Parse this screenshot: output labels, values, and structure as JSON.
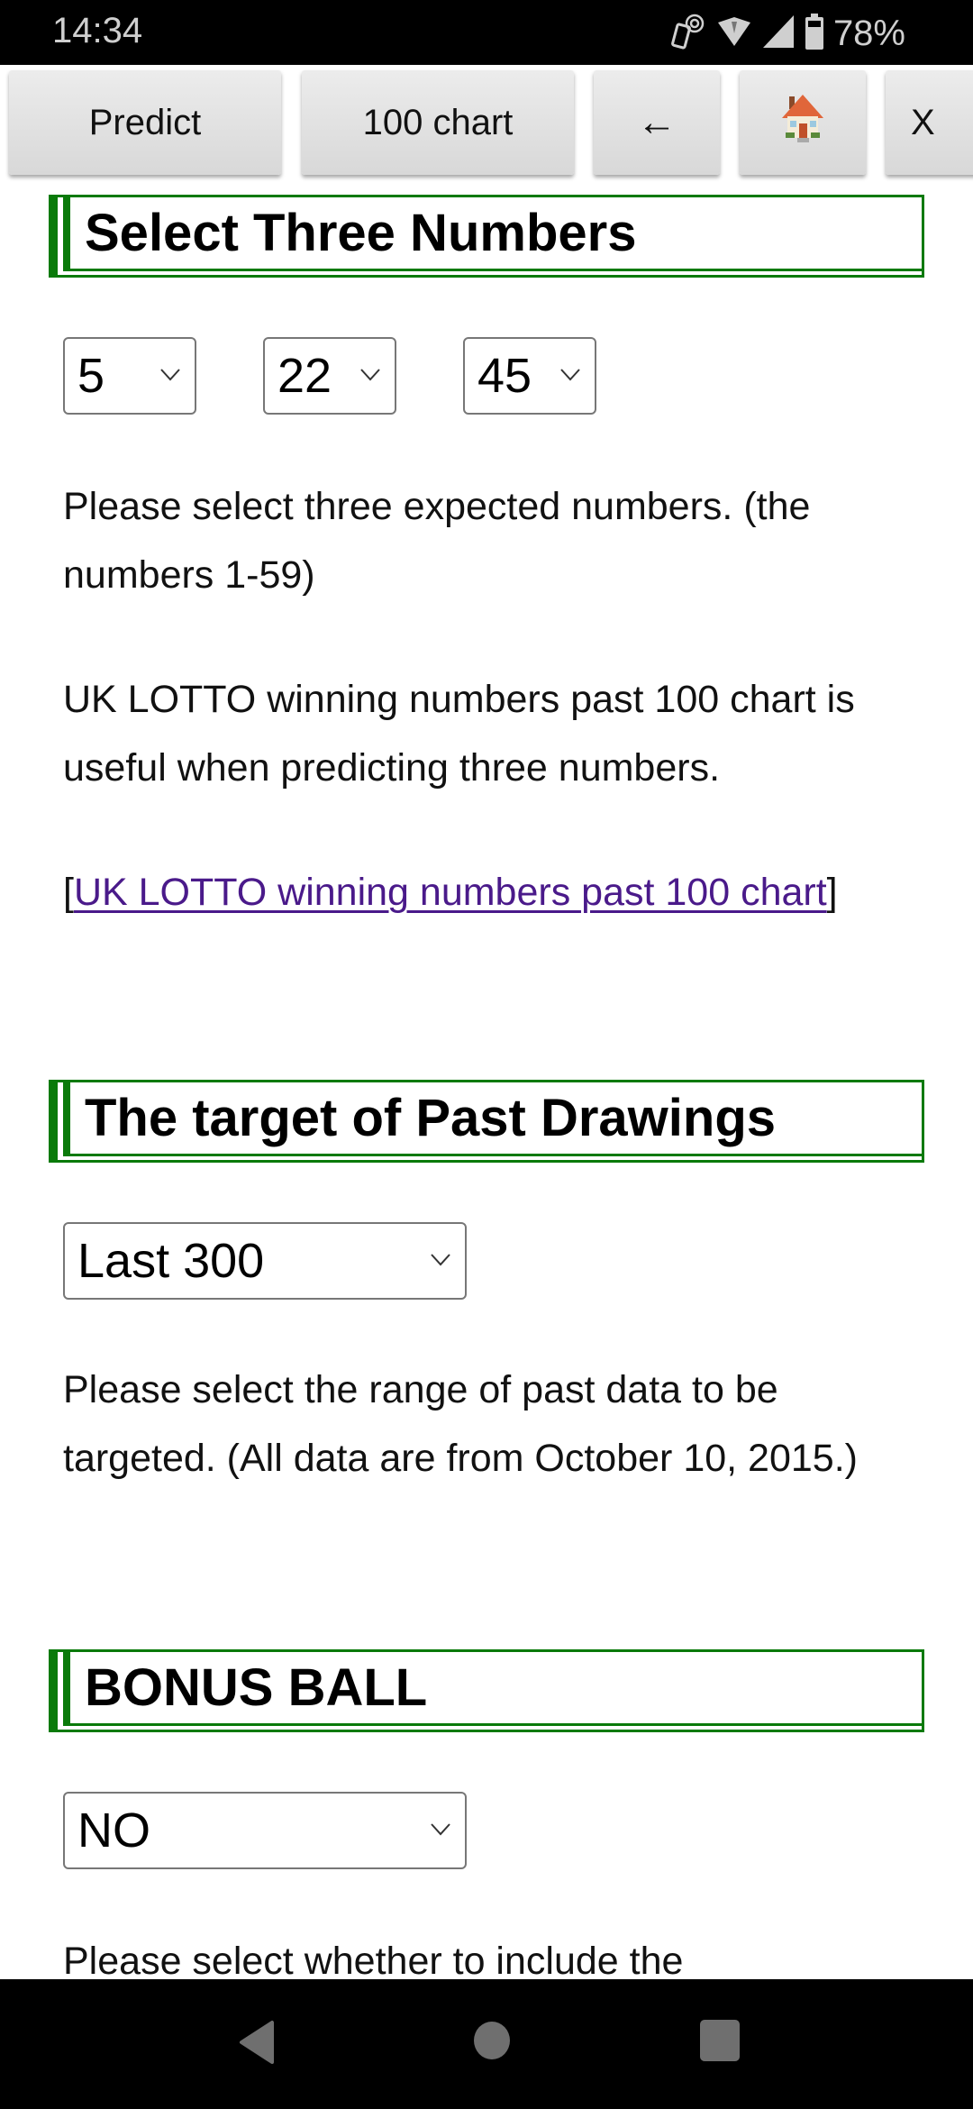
{
  "status_bar": {
    "time": "14:34",
    "battery_percent": "78%",
    "icons": [
      "nfc-icon",
      "wifi-icon",
      "signal-icon",
      "battery-icon"
    ]
  },
  "toolbar": {
    "predict_label": "Predict",
    "chart_label": "100 chart",
    "back_label": "←",
    "home_label": "🏠",
    "close_label": "X"
  },
  "sections": [
    {
      "heading": "Select Three Numbers",
      "selects": [
        "5",
        "22",
        "45"
      ],
      "paragraphs": [
        "Please select three expected numbers. (the numbers 1-59)",
        "UK LOTTO winning numbers past 100 chart is useful when predicting three numbers."
      ],
      "link": {
        "open_bracket": "[",
        "text": "UK LOTTO winning numbers past 100 chart",
        "close_bracket": "]"
      }
    },
    {
      "heading": "The target of Past Drawings",
      "select": "Last 300",
      "paragraph": "Please select the range of past data to be targeted. (All data are from October 10, 2015.)"
    },
    {
      "heading": "BONUS BALL",
      "select": "NO",
      "paragraph": "Please select whether to include the"
    }
  ],
  "colors": {
    "heading_border": "#0a7a0a",
    "link": "#4a1a8a"
  }
}
